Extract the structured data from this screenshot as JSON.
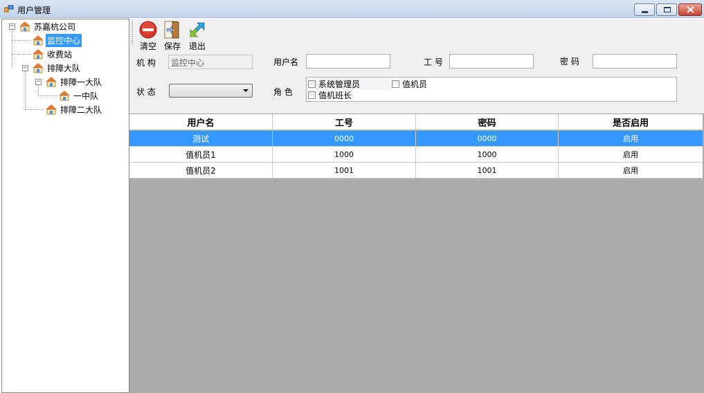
{
  "window": {
    "title": "用户管理"
  },
  "tree": {
    "root": {
      "label": "苏嘉杭公司"
    },
    "monitor_center": {
      "label": "监控中心"
    },
    "toll_station": {
      "label": "收费站"
    },
    "rescue_brigade": {
      "label": "排障大队"
    },
    "rescue_unit_1": {
      "label": "排障一大队"
    },
    "squadron_1": {
      "label": "一中队"
    },
    "rescue_unit_2": {
      "label": "排障二大队"
    }
  },
  "toolbar": {
    "clear_label": "清空",
    "save_label": "保存",
    "exit_label": "退出"
  },
  "form": {
    "org_label": "机 构",
    "org_value": "监控中心",
    "username_label": "用户名",
    "username_value": "",
    "workno_label": "工 号",
    "workno_value": "",
    "password_label": "密 码",
    "password_value": "",
    "status_label": "状 态",
    "status_value": "",
    "role_label": "角 色",
    "roles": {
      "admin": {
        "label": "系统管理员",
        "checked": false
      },
      "operator": {
        "label": "值机员",
        "checked": false
      },
      "shift_leader": {
        "label": "值机班长",
        "checked": false
      }
    }
  },
  "grid": {
    "columns": [
      "用户名",
      "工号",
      "密码",
      "是否启用"
    ],
    "rows": [
      {
        "username": "测试",
        "workno": "0000",
        "password": "0000",
        "enabled": "启用",
        "selected": true
      },
      {
        "username": "值机员1",
        "workno": "1000",
        "password": "1000",
        "enabled": "启用",
        "selected": false
      },
      {
        "username": "值机员2",
        "workno": "1001",
        "password": "1001",
        "enabled": "启用",
        "selected": false
      }
    ]
  },
  "colors": {
    "selection": "#3399ff",
    "grid_background": "#ababab",
    "panel_background": "#f0f0f0"
  }
}
